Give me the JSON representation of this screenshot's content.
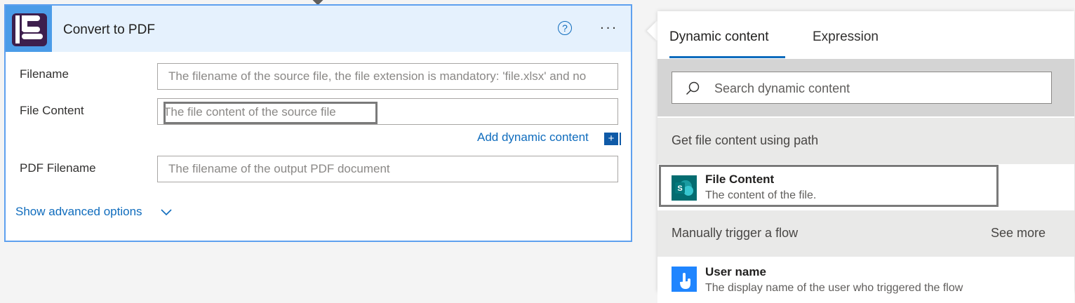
{
  "action_card": {
    "title": "Convert to PDF",
    "app_icon": "document-app-icon",
    "help_icon": "?",
    "more_icon": "...",
    "fields": [
      {
        "label": "Filename",
        "placeholder": "The filename of the source file, the file extension is mandatory: 'file.xlsx' and no"
      },
      {
        "label": "File Content",
        "placeholder": "The file content of the source file"
      },
      {
        "label": "PDF Filename",
        "placeholder": "The filename of the output PDF document"
      }
    ],
    "add_dynamic_label": "Add dynamic content",
    "add_dynamic_plus": "+",
    "show_advanced_label": "Show advanced options"
  },
  "panel": {
    "tabs": [
      {
        "label": "Dynamic content",
        "active": true
      },
      {
        "label": "Expression",
        "active": false
      }
    ],
    "search_placeholder": "Search dynamic content",
    "sections": [
      {
        "title": "Get file content using path",
        "items": [
          {
            "name": "File Content",
            "description": "The content of the file.",
            "icon": "sharepoint-icon"
          }
        ]
      },
      {
        "title": "Manually trigger a flow",
        "see_more": "See more",
        "items": [
          {
            "name": "User name",
            "description": "The display name of the user who triggered the flow",
            "icon": "touch-icon"
          }
        ]
      }
    ]
  },
  "colors": {
    "accent": "#0f6cbd",
    "card_border": "#5ea0ef",
    "header_bg": "#e5f1fd",
    "sharepoint": "#036c70",
    "trigger": "#1f85ff"
  }
}
